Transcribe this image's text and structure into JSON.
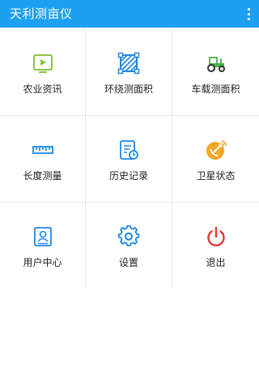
{
  "appbar": {
    "title": "天利测亩仪",
    "menu_icon": "more-vert-icon",
    "color": "#1ea0f2"
  },
  "menu": {
    "items": [
      {
        "label": "农业资讯",
        "icon": "video-icon",
        "color": "#8bc34a"
      },
      {
        "label": "环绕测面积",
        "icon": "hatched-square-icon",
        "color": "#1e88e5"
      },
      {
        "label": "车载测面积",
        "icon": "tractor-icon",
        "color": "#4caf50"
      },
      {
        "label": "长度测量",
        "icon": "ruler-icon",
        "color": "#1e88e5"
      },
      {
        "label": "历史记录",
        "icon": "history-document-icon",
        "color": "#1e88e5"
      },
      {
        "label": "卫星状态",
        "icon": "satellite-dish-icon",
        "color": "#f5a623"
      },
      {
        "label": "用户中心",
        "icon": "user-card-icon",
        "color": "#1e88e5"
      },
      {
        "label": "设置",
        "icon": "gear-icon",
        "color": "#1e88e5"
      },
      {
        "label": "退出",
        "icon": "power-icon",
        "color": "#e53935"
      }
    ]
  }
}
